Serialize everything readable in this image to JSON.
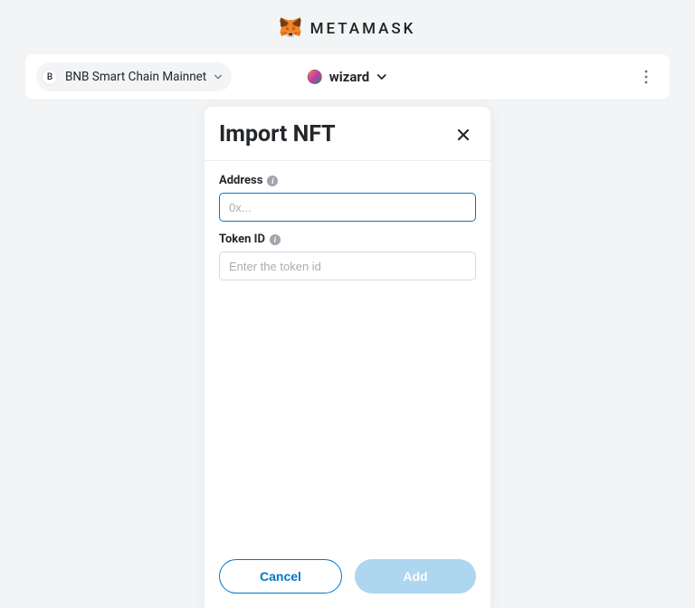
{
  "brand": {
    "name": "METAMASK"
  },
  "network": {
    "letter": "B",
    "name": "BNB Smart Chain Mainnet"
  },
  "account": {
    "name": "wizard"
  },
  "modal": {
    "title": "Import NFT",
    "address": {
      "label": "Address",
      "placeholder": "0x...",
      "value": ""
    },
    "tokenId": {
      "label": "Token ID",
      "placeholder": "Enter the token id",
      "value": ""
    },
    "buttons": {
      "cancel": "Cancel",
      "add": "Add"
    }
  }
}
